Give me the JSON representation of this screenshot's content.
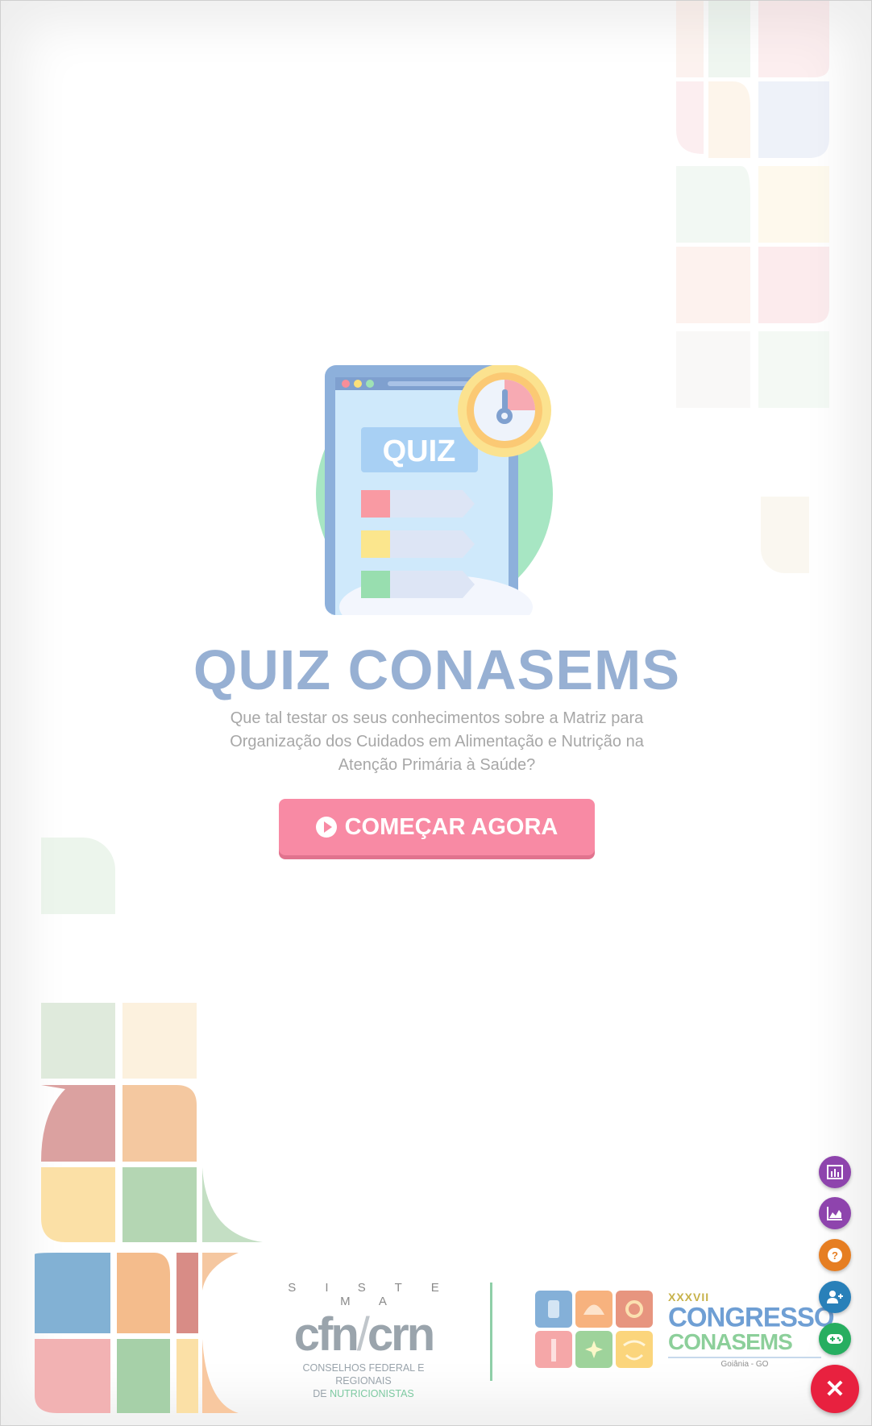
{
  "quiz": {
    "title": "QUIZ CONASEMS",
    "subtitle": "Que tal testar os seus conhecimentos sobre a Matriz para Organização dos Cuidados em Alimentação e Nutrição na Atenção Primária à Saúde?",
    "start_label": "COMEÇAR AGORA",
    "illustration_label": "QUIZ"
  },
  "footer": {
    "cfn_top": "S I S T E M A",
    "cfn_mark_left": "cfn",
    "cfn_mark_slash": "/",
    "cfn_mark_right": "crn",
    "cfn_sub_line1": "CONSELHOS FEDERAL E REGIONAIS",
    "cfn_sub_line2_prefix": "DE",
    "cfn_sub_line2_highlight": "NUTRICIONISTAS",
    "congresso_edition": "XXXVII",
    "congresso_line1": "CONGRESSO",
    "congresso_line2": "CONASEMS",
    "congresso_location": "Goiânia - GO"
  },
  "fabs": [
    {
      "icon": "bar-chart-icon",
      "color": "#8e44ad"
    },
    {
      "icon": "area-chart-icon",
      "color": "#8e44ad"
    },
    {
      "icon": "help-icon",
      "color": "#e67e22"
    },
    {
      "icon": "add-user-icon",
      "color": "#2980b9"
    },
    {
      "icon": "gamepad-icon",
      "color": "#27ae60"
    }
  ],
  "close_icon": "close-icon",
  "close_color": "#e8213f",
  "accent_color": "#f88aa4",
  "title_color": "#97b0d3"
}
